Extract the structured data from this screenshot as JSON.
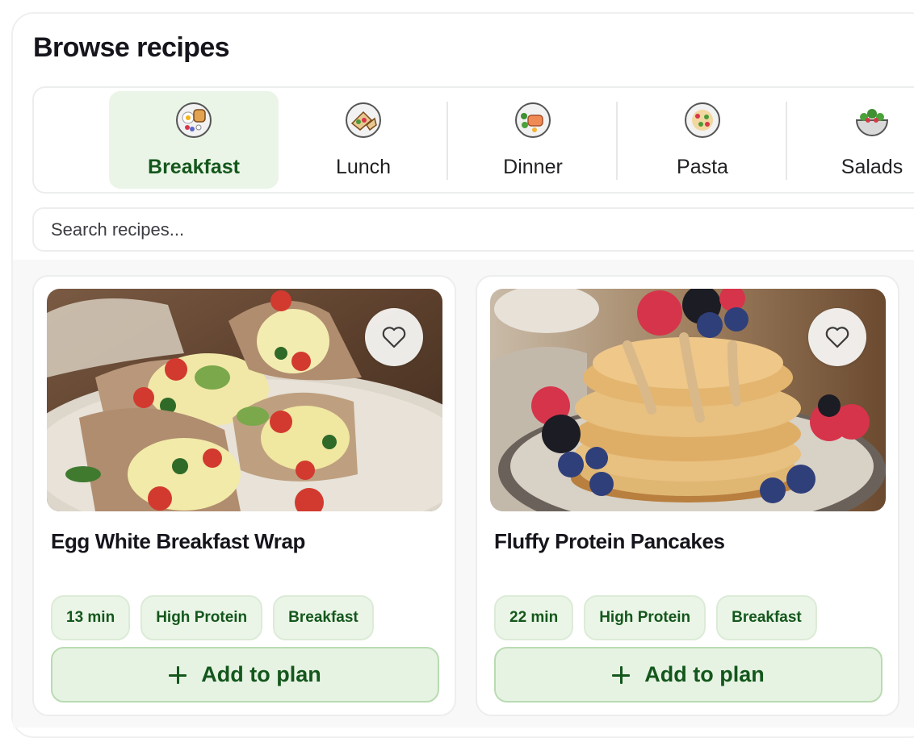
{
  "page": {
    "title": "Browse recipes"
  },
  "categories": [
    {
      "label": "Breakfast",
      "icon": "breakfast-plate-icon",
      "active": true
    },
    {
      "label": "Lunch",
      "icon": "wrap-plate-icon",
      "active": false
    },
    {
      "label": "Dinner",
      "icon": "salmon-plate-icon",
      "active": false
    },
    {
      "label": "Pasta",
      "icon": "pasta-plate-icon",
      "active": false
    },
    {
      "label": "Salads",
      "icon": "salad-bowl-icon",
      "active": false
    }
  ],
  "search": {
    "placeholder": "Search recipes...",
    "value": ""
  },
  "recipes": [
    {
      "title": "Egg White Breakfast Wrap",
      "image": "egg-white-wrap-photo",
      "tags": [
        "13 min",
        "High Protein",
        "Breakfast"
      ],
      "add_label": "Add to plan"
    },
    {
      "title": "Fluffy Protein Pancakes",
      "image": "protein-pancakes-photo",
      "tags": [
        "22 min",
        "High Protein",
        "Breakfast"
      ],
      "add_label": "Add to plan"
    }
  ],
  "colors": {
    "accent": "#14571c",
    "accent_bg": "#eaf5e7",
    "border": "#eceeed"
  }
}
